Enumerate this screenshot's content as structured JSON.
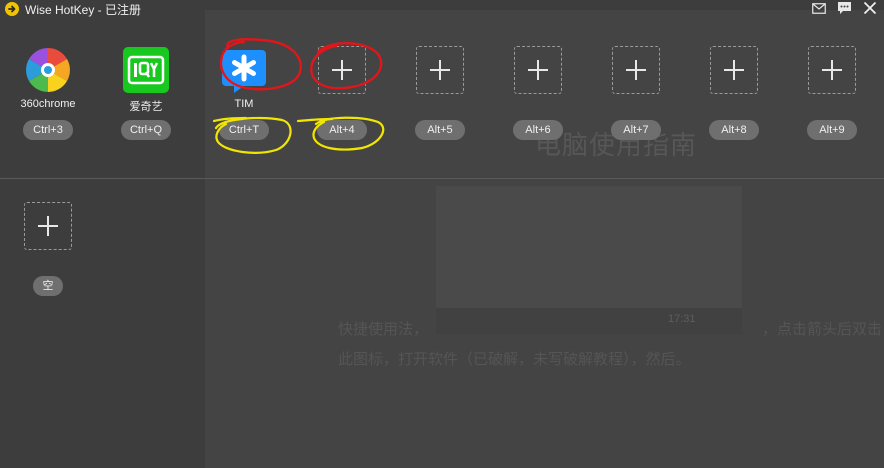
{
  "window": {
    "title": "Wise HotKey - 已注册",
    "accent": "#f2c300"
  },
  "toolbar": {
    "mail_icon": "mail-icon",
    "feedback_icon": "chat-icon",
    "close_icon": "close-icon"
  },
  "apps": [
    {
      "name": "360chrome",
      "hotkey": "Ctrl+3",
      "icon": "360chrome-icon"
    },
    {
      "name": "爱奇艺",
      "hotkey": "Ctrl+Q",
      "icon": "iqiyi-icon"
    },
    {
      "name": "TIM",
      "hotkey": "Ctrl+T",
      "icon": "tim-icon"
    },
    {
      "name": "",
      "hotkey": "Alt+4",
      "icon": "add-icon"
    },
    {
      "name": "",
      "hotkey": "Alt+5",
      "icon": "add-icon"
    },
    {
      "name": "",
      "hotkey": "Alt+6",
      "icon": "add-icon"
    },
    {
      "name": "",
      "hotkey": "Alt+7",
      "icon": "add-icon"
    },
    {
      "name": "",
      "hotkey": "Alt+8",
      "icon": "add-icon"
    },
    {
      "name": "",
      "hotkey": "Alt+9",
      "icon": "add-icon"
    }
  ],
  "groups": [
    {
      "label": "空",
      "icon": "add-icon"
    }
  ],
  "background": {
    "title": "电脑使用指南",
    "clock": "17:31",
    "para_line1": "快捷使用法，",
    "para_line1_tail": "，点击箭头后双击",
    "para_line2": "此图标，打开软件（已破解，未写破解教程），然后。"
  }
}
